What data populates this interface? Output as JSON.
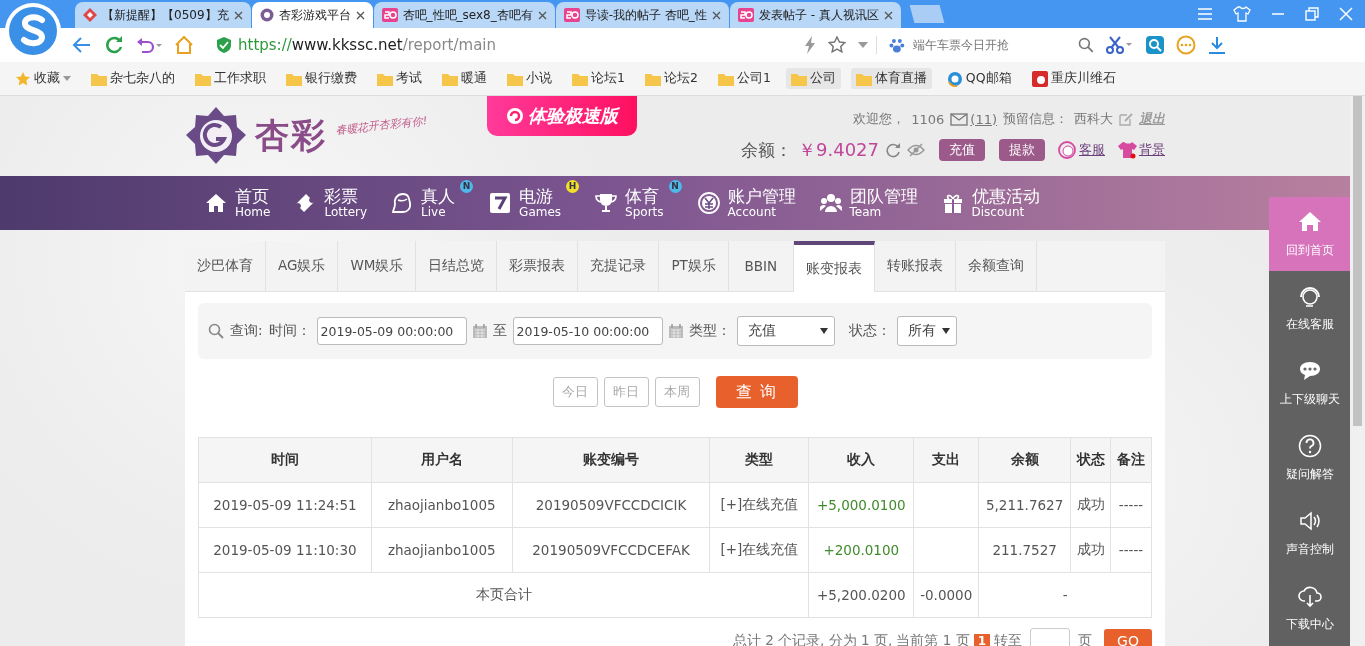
{
  "browser": {
    "tabs": [
      {
        "title": "【新提醒】【0509】充",
        "selected": false,
        "kind": "diamond"
      },
      {
        "title": "杏彩游戏平台",
        "selected": true,
        "kind": "logo"
      },
      {
        "title": "杏吧_性吧_sex8_杏吧有",
        "selected": false,
        "kind": "forum"
      },
      {
        "title": "导读-我的帖子 杏吧_性",
        "selected": false,
        "kind": "forum"
      },
      {
        "title": "发表帖子 - 真人视讯区",
        "selected": false,
        "kind": "forum"
      }
    ],
    "url": {
      "scheme": "https://",
      "host": "www.kkssc.net",
      "path": "/report/main"
    },
    "search": {
      "placeholder": "端午车票今日开抢"
    },
    "bookmarks": [
      {
        "label": "收藏",
        "kind": "menu"
      },
      {
        "label": "杂七杂八的",
        "kind": "folder"
      },
      {
        "label": "工作求职",
        "kind": "folder"
      },
      {
        "label": "银行缴费",
        "kind": "folder"
      },
      {
        "label": "考试",
        "kind": "folder"
      },
      {
        "label": "暖通",
        "kind": "folder"
      },
      {
        "label": "小说",
        "kind": "folder"
      },
      {
        "label": "论坛1",
        "kind": "folder"
      },
      {
        "label": "论坛2",
        "kind": "folder"
      },
      {
        "label": "公司1",
        "kind": "folder"
      },
      {
        "label": "公司",
        "kind": "folder_pill"
      },
      {
        "label": "体育直播",
        "kind": "folder_pill"
      },
      {
        "label": "QQ邮箱",
        "kind": "mail"
      },
      {
        "label": "重庆川维石",
        "kind": "site"
      }
    ]
  },
  "header": {
    "logo": "杏彩",
    "slogan": "春暖花开杏彩有你!",
    "promo": "体验极速版",
    "welcome": "欢迎您，",
    "user": "1106",
    "messages": "(11)",
    "reserved_label": "预留信息：",
    "reserved_value": "西科大",
    "logout": "退出",
    "balance_label": "余额：",
    "balance": "￥9.4027",
    "buttons": [
      "充值",
      "提款"
    ],
    "links": [
      {
        "label": "客服",
        "kind": "service"
      },
      {
        "label": "背景",
        "kind": "shirt"
      }
    ]
  },
  "nav": [
    {
      "zh": "首页",
      "en": "Home",
      "kind": "home"
    },
    {
      "zh": "彩票",
      "en": "Lottery",
      "kind": "ticket"
    },
    {
      "zh": "真人",
      "en": "Live",
      "kind": "lady",
      "badge": "N",
      "color": "#4fb8e8"
    },
    {
      "zh": "电游",
      "en": "Games",
      "kind": "seven",
      "badge": "H",
      "color": "#f2e02a"
    },
    {
      "zh": "体育",
      "en": "Sports",
      "kind": "trophy",
      "badge": "N",
      "color": "#4fb8e8"
    },
    {
      "zh": "账户管理",
      "en": "Account",
      "kind": "coin"
    },
    {
      "zh": "团队管理",
      "en": "Team",
      "kind": "team"
    },
    {
      "zh": "优惠活动",
      "en": "Discount",
      "kind": "gift"
    }
  ],
  "report": {
    "tabs": [
      {
        "label": "沙巴体育",
        "selected": false
      },
      {
        "label": "AG娱乐",
        "selected": false
      },
      {
        "label": "WM娱乐",
        "selected": false
      },
      {
        "label": "日结总览",
        "selected": false
      },
      {
        "label": "彩票报表",
        "selected": false
      },
      {
        "label": "充提记录",
        "selected": false
      },
      {
        "label": "PT娱乐",
        "selected": false
      },
      {
        "label": "BBIN",
        "selected": false
      },
      {
        "label": "账变报表",
        "selected": true
      },
      {
        "label": "转账报表",
        "selected": false
      },
      {
        "label": "余额查询",
        "selected": false
      }
    ],
    "filter": {
      "query_label": "查询:",
      "time_label": "时间：",
      "from": "2019-05-09 00:00:00",
      "to_label": "至",
      "to": "2019-05-10 00:00:00",
      "type_label": "类型：",
      "type": "充值",
      "status_label": "状态：",
      "status": "所有"
    },
    "quick_buttons": [
      "今日",
      "昨日",
      "本周"
    ],
    "search_button": "查 询",
    "table": {
      "columns": [
        "时间",
        "用户名",
        "账变编号",
        "类型",
        "收入",
        "支出",
        "余额",
        "状态",
        "备注"
      ],
      "rows": [
        [
          "2019-05-09 11:24:51",
          "zhaojianbo1005",
          "20190509VFCCDCICIK",
          "[+]在线充值",
          "+5,000.0100",
          "",
          "5,211.7627",
          "成功",
          "-----"
        ],
        [
          "2019-05-09 11:10:30",
          "zhaojianbo1005",
          "20190509VFCCDCEFAK",
          "[+]在线充值",
          "+200.0100",
          "",
          "211.7527",
          "成功",
          "-----"
        ]
      ],
      "total": {
        "label": "本页合计",
        "income": "+5,200.0200",
        "expense": "-0.0000",
        "balance": "-"
      }
    },
    "pagination": {
      "summary": "总计 2 个记录, 分为 1 页, 当前第 1 页",
      "current": "1",
      "goto_label": "转至",
      "page_label": "页",
      "go": "GO"
    }
  },
  "dock": [
    {
      "label": "回到首页",
      "kind": "home",
      "selected": true
    },
    {
      "label": "在线客服",
      "kind": "headset",
      "selected": false
    },
    {
      "label": "上下级聊天",
      "kind": "chat",
      "selected": false
    },
    {
      "label": "疑问解答",
      "kind": "question",
      "selected": false
    },
    {
      "label": "声音控制",
      "kind": "speaker",
      "selected": false
    },
    {
      "label": "下载中心",
      "kind": "cloud",
      "selected": false
    }
  ]
}
